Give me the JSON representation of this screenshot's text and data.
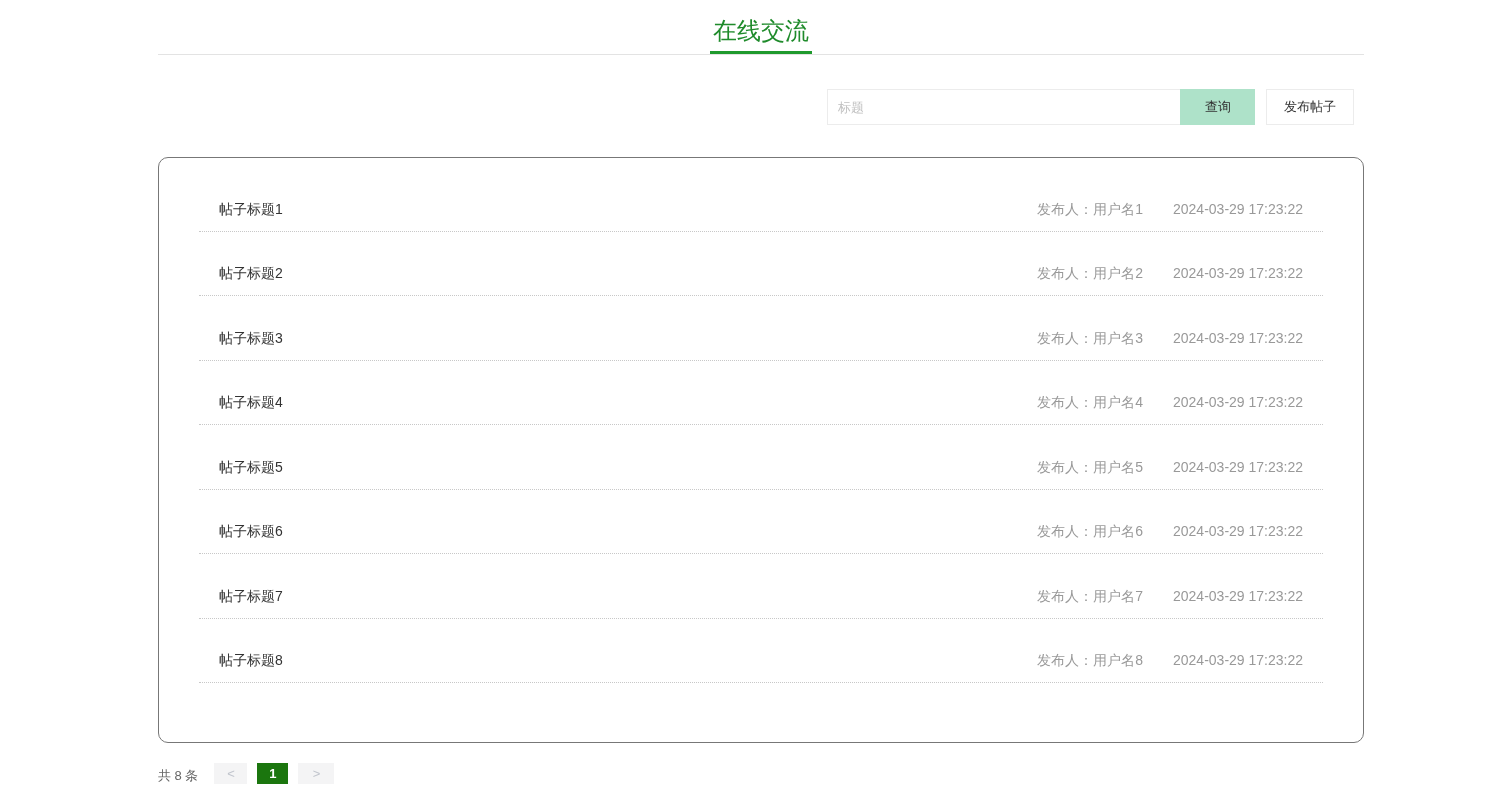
{
  "header": {
    "title": "在线交流"
  },
  "search": {
    "placeholder": "标题",
    "button": "查询"
  },
  "publish_button": "发布帖子",
  "posts": [
    {
      "title": "帖子标题1",
      "author": "发布人：用户名1",
      "time": "2024-03-29 17:23:22"
    },
    {
      "title": "帖子标题2",
      "author": "发布人：用户名2",
      "time": "2024-03-29 17:23:22"
    },
    {
      "title": "帖子标题3",
      "author": "发布人：用户名3",
      "time": "2024-03-29 17:23:22"
    },
    {
      "title": "帖子标题4",
      "author": "发布人：用户名4",
      "time": "2024-03-29 17:23:22"
    },
    {
      "title": "帖子标题5",
      "author": "发布人：用户名5",
      "time": "2024-03-29 17:23:22"
    },
    {
      "title": "帖子标题6",
      "author": "发布人：用户名6",
      "time": "2024-03-29 17:23:22"
    },
    {
      "title": "帖子标题7",
      "author": "发布人：用户名7",
      "time": "2024-03-29 17:23:22"
    },
    {
      "title": "帖子标题8",
      "author": "发布人：用户名8",
      "time": "2024-03-29 17:23:22"
    }
  ],
  "pagination": {
    "total": "共 8 条",
    "prev": {
      "label": "<",
      "disabled": true
    },
    "pages": [
      {
        "label": "1",
        "selected": true
      }
    ],
    "next": {
      "label": ">",
      "disabled": true
    }
  }
}
